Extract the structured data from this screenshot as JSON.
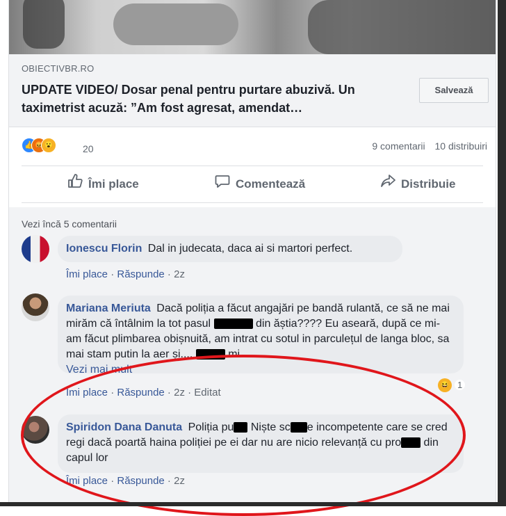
{
  "post": {
    "domain": "OBIECTIVBR.RO",
    "headline": "UPDATE VIDEO/ Dosar penal pentru purtare abuzivă. Un taximetrist acuză: ”Am fost agresat, amendat…",
    "save_label": "Salvează"
  },
  "stats": {
    "reaction_count": "20",
    "comments": "9 comentarii",
    "shares": "10 distribuiri"
  },
  "actions": {
    "like": "Îmi place",
    "comment": "Comentează",
    "share": "Distribuie"
  },
  "comments_section": {
    "more_label": "Vezi încă 5 comentarii",
    "items": [
      {
        "name": "Ionescu Florin",
        "text": "Dal in judecata, daca ai si martori perfect.",
        "like": "Îmi place",
        "reply": "Răspunde",
        "time": "2z"
      },
      {
        "name": "Mariana Meriuta",
        "text_1": "Dacă poliția a făcut angajări pe bandă rulantă, ce să ne mai mirăm că întâlnim la tot pasul",
        "text_2": "din ăștia???? Eu aseară, după ce mi-am făcut plimbarea obișnuită, am intrat cu sotul in parculețul de langa bloc, sa mai stam putin la aer și....",
        "text_3": "mi...",
        "see_more": "Vezi mai mult",
        "like": "Îmi place",
        "reply": "Răspunde",
        "time": "2z",
        "edited": "Editat",
        "reaction_count": "1"
      },
      {
        "name": "Spiridon Dana Danuta",
        "text_1": "Poliția pu",
        "text_2": "Niște sc",
        "text_3": "e incompetente care se cred regi dacă poartă haina poliției pe ei dar nu are nicio relevanță cu pro",
        "text_4": "din capul lor",
        "like": "Îmi place",
        "reply": "Răspunde",
        "time": "2z"
      }
    ]
  },
  "icons": {
    "like": "thumbs-up-icon",
    "comment": "speech-bubble-icon",
    "share": "share-arrow-icon"
  },
  "colors": {
    "link": "#385898",
    "annotation": "#e0161b"
  }
}
